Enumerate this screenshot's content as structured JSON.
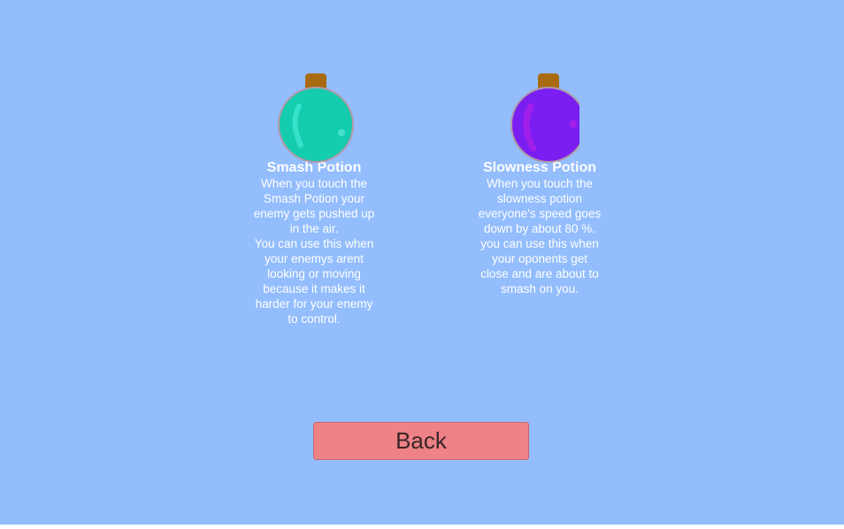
{
  "potions": [
    {
      "title": "Smash Potion",
      "description": "When you touch the Smash Potion your enemy gets pushed up in the air.\nYou can use this when your enemys arent looking or moving because it makes it harder for your enemy to control.",
      "icon": "smash-potion-icon",
      "color": "#14ccae"
    },
    {
      "title": "Slowness Potion",
      "description": "When you touch the slowness potion everyone's speed goes down by about 80 %.\nyou can use this when your oponents get close and are about to smash on you.",
      "icon": "slowness-potion-icon",
      "color": "#7b1ef2"
    }
  ],
  "back_button": {
    "label": "Back"
  },
  "colors": {
    "background": "#93bdfd",
    "button": "#ee8287",
    "cork": "#a86b12"
  }
}
